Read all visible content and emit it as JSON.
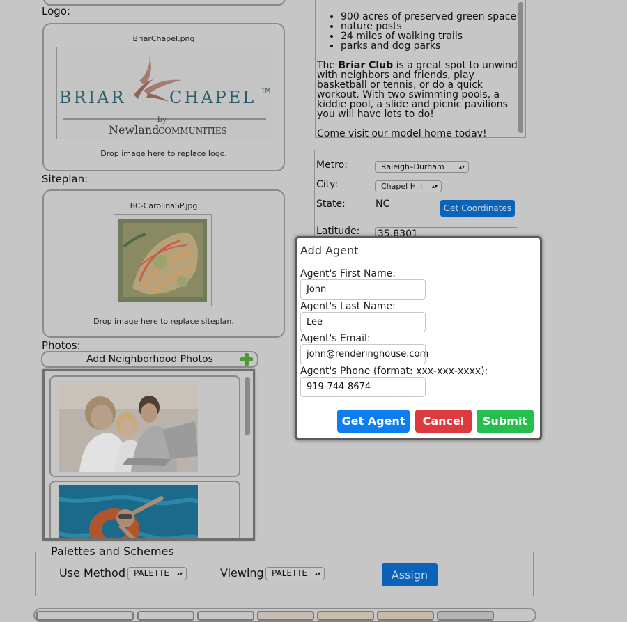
{
  "logo_section": {
    "label": "Logo:",
    "filename": "BriarChapel.png",
    "logo_word_left": "BRIAR",
    "logo_word_right": "CHAPEL",
    "logo_tm": "TM",
    "logo_by": "by",
    "logo_brand": "Newland",
    "logo_brand_small": "COMMUNITIES",
    "hint": "Drop image here to replace logo."
  },
  "siteplan_section": {
    "label": "Siteplan:",
    "filename": "BC-CarolinaSP.jpg",
    "hint": "Drop image here to replace siteplan."
  },
  "photos_section": {
    "label": "Photos:",
    "add_button": "Add Neighborhood Photos"
  },
  "description": {
    "bullets": [
      "900 acres of preserved green space",
      "nature posts",
      "24 miles of walking trails",
      "parks and dog parks"
    ],
    "para1_pre": "The ",
    "para1_bold": "Briar Club",
    "para1_post": " is a great spot to unwind with neighbors and friends, play basketball or tennis, or do a quick workout. With two swimming pools, a kiddie pool, a slide and picnic pavilions you will have lots to do!",
    "para2": "Come visit our model home today!"
  },
  "location": {
    "metro_label": "Metro:",
    "metro_value": "Raleigh–Durham",
    "city_label": "City:",
    "city_value": "Chapel Hill",
    "state_label": "State:",
    "state_value": "NC",
    "coords_button": "Get Coordinates",
    "latitude_label": "Latitude:",
    "latitude_value": "35.8301"
  },
  "modal": {
    "title": "Add Agent",
    "first_label": "Agent's First Name:",
    "first_value": "John",
    "last_label": "Agent's Last Name:",
    "last_value": "Lee",
    "email_label": "Agent's Email:",
    "email_value": "john@renderinghouse.com",
    "phone_label": "Agent's Phone (format: xxx-xxx-xxxx):",
    "phone_value": "919-744-8674",
    "get_button": "Get Agent",
    "cancel_button": "Cancel",
    "submit_button": "Submit"
  },
  "palettes": {
    "legend": "Palettes and Schemes",
    "use_method_label": "Use Method",
    "use_method_value": "PALETTE",
    "viewing_label": "Viewing",
    "viewing_value": "PALETTE",
    "assign_button": "Assign"
  },
  "colors": {
    "overlay_bg": "#c6c6c6",
    "primary_blue": "#0d7ef0",
    "danger_red": "#dc3a3f",
    "success_green": "#26bf4f",
    "dimmed_blue": "#0a63b8"
  }
}
